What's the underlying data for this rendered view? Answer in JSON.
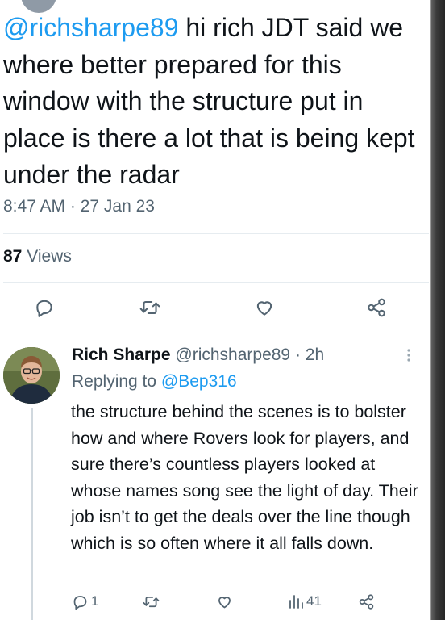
{
  "main_tweet": {
    "mention": "@richsharpe89",
    "text": " hi rich JDT said we where better prepared for this window with the structure put in place is there a lot that is being kept under the radar",
    "timestamp": "8:47 AM · 27 Jan 23",
    "views_count": "87",
    "views_label": " Views",
    "actions": [
      "reply-icon",
      "retweet-icon",
      "like-icon",
      "share-icon"
    ]
  },
  "reply": {
    "name": "Rich Sharpe",
    "meta": " @richsharpe89 · 2h",
    "replying_prefix": "Replying to ",
    "replying_to": "@Bep316",
    "text": "the structure behind the scenes is to bolster how and where Rovers look for players, and sure there’s countless players looked at whose names song see the light of day. Their job isn’t to get the deals over the line though which is so often where it all falls down.",
    "reply_count": "1",
    "views_count": "41"
  },
  "colors": {
    "link": "#1d9bf0",
    "secondary": "#536471",
    "text": "#0f1419",
    "divider": "#e6ecf0"
  }
}
